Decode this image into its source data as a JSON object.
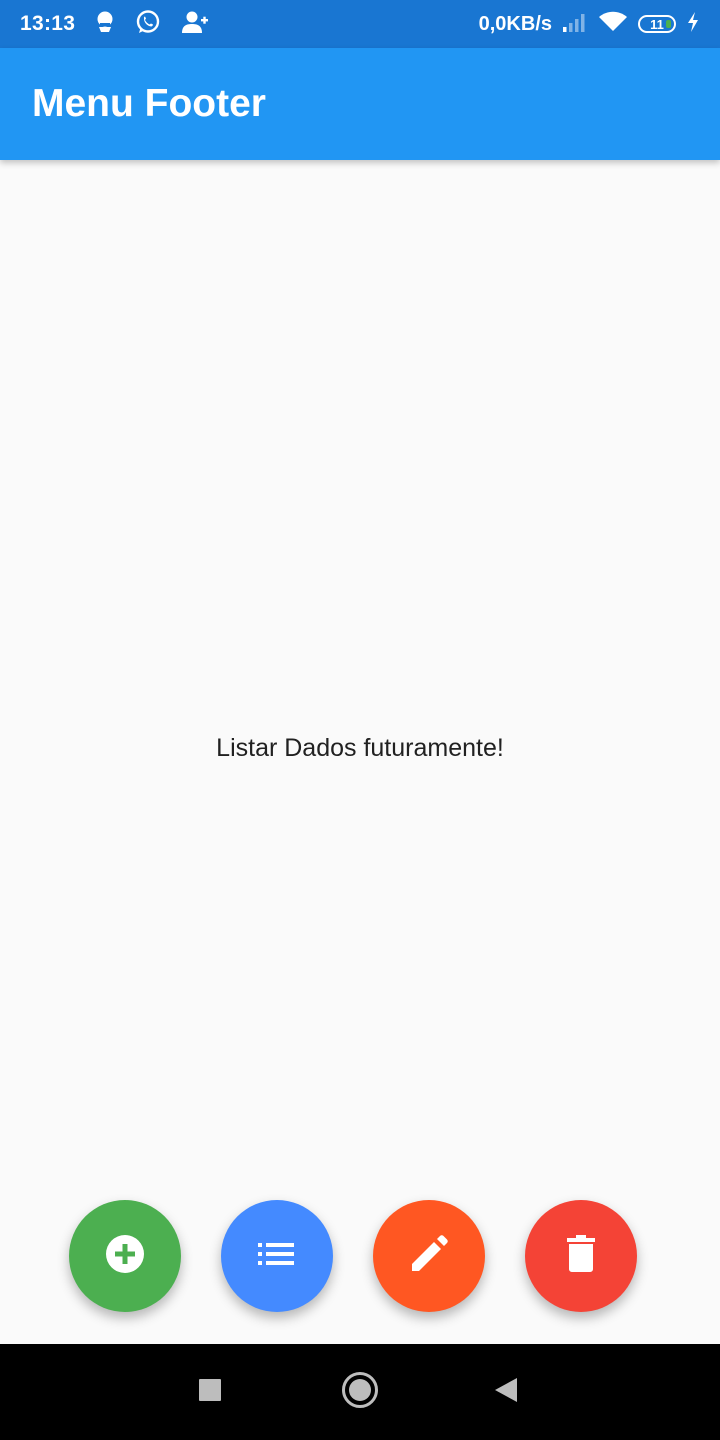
{
  "status_bar": {
    "time": "13:13",
    "left_icons": [
      "notification-icon",
      "whatsapp-icon",
      "person-add-icon"
    ],
    "net_speed": "0,0KB/s",
    "battery_level": "11",
    "right_icons": [
      "signal-icon",
      "wifi-icon",
      "battery-icon",
      "charging-icon"
    ]
  },
  "app_bar": {
    "title": "Menu Footer"
  },
  "main": {
    "message": "Listar Dados futuramente!"
  },
  "fab_buttons": [
    {
      "name": "add",
      "icon": "add-circle-icon",
      "color": "#4caf50"
    },
    {
      "name": "list",
      "icon": "list-icon",
      "color": "#448aff"
    },
    {
      "name": "edit",
      "icon": "edit-pencil-icon",
      "color": "#ff5722"
    },
    {
      "name": "delete",
      "icon": "trash-icon",
      "color": "#f44336"
    }
  ],
  "nav_bar": {
    "buttons": [
      "recents-icon",
      "home-icon",
      "back-icon"
    ]
  },
  "colors": {
    "status_bar": "#1976d2",
    "app_bar": "#2196f3",
    "background": "#fafafa",
    "nav_bar": "#000000"
  }
}
